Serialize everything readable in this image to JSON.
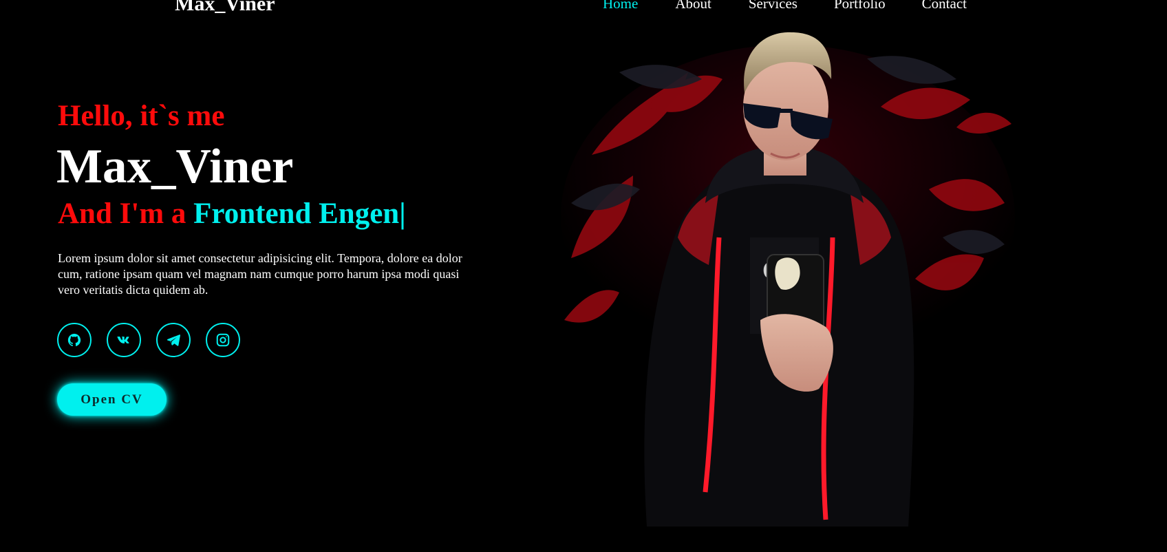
{
  "header": {
    "logo": "Max_Viner",
    "nav": [
      {
        "label": "Home",
        "active": true
      },
      {
        "label": "About",
        "active": false
      },
      {
        "label": "Services",
        "active": false
      },
      {
        "label": "Portfolio",
        "active": false
      },
      {
        "label": "Contact",
        "active": false
      }
    ]
  },
  "hero": {
    "greeting": "Hello, it`s me",
    "name": "Max_Viner",
    "role_prefix": "And I'm a ",
    "role_typed": "Frontend Engen|",
    "bio": "Lorem ipsum dolor sit amet consectetur adipisicing elit. Tempora, dolore ea dolor cum, ratione ipsam quam vel magnam nam cumque porro harum ipsa modi quasi vero veritatis dicta quidem ab.",
    "socials": [
      {
        "icon": "github-icon"
      },
      {
        "icon": "vk-icon"
      },
      {
        "icon": "telegram-icon"
      },
      {
        "icon": "instagram-icon"
      }
    ],
    "cv_button": "Open CV"
  },
  "colors": {
    "accent": "#00f0ee",
    "highlight": "#ff0b0b",
    "background": "#000000"
  }
}
